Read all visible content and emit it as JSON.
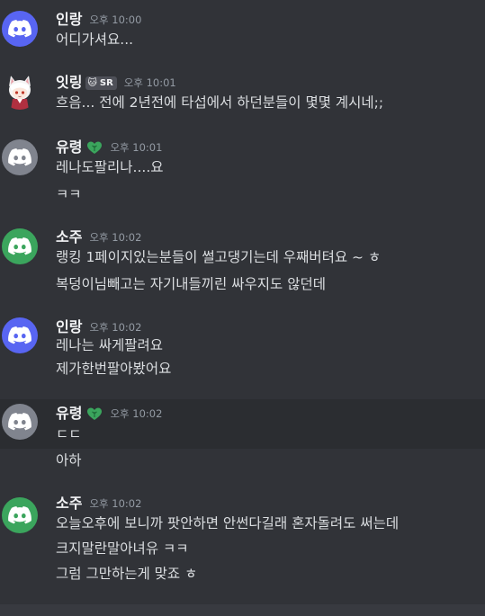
{
  "messages": [
    {
      "username": "인랑",
      "timestamp": "오후 10:00",
      "avatar": "discord-default-blurple",
      "lines": [
        "어디가셔요..."
      ]
    },
    {
      "username": "잇링",
      "timestamp": "오후 10:01",
      "avatar": "anime-character",
      "tag": {
        "icon": "cat-face-icon",
        "label": "SR"
      },
      "lines": [
        "흐음... 전에 2년전에 타섭에서 하던분들이 몇몇 계시네;;"
      ]
    },
    {
      "username": "유령",
      "timestamp": "오후 10:01",
      "avatar": "discord-default-gray",
      "badge": "green-heart-leaf-icon",
      "lines": [
        "레나도팔리나....요",
        "ㅋㅋ"
      ]
    },
    {
      "username": "소주",
      "timestamp": "오후 10:02",
      "avatar": "discord-default-green",
      "lines": [
        "랭킹 1페이지있는분들이 썰고댕기는데 우째버텨요 ~ ㅎ",
        "복덩이님빼고는 자기내들끼린 싸우지도 않던데"
      ]
    },
    {
      "username": "인랑",
      "timestamp": "오후 10:02",
      "avatar": "discord-default-blurple",
      "lines": [
        "레나는 싸게팔려요",
        "제가한번팔아봤어요"
      ]
    },
    {
      "username": "유령",
      "timestamp": "오후 10:02",
      "avatar": "discord-default-gray",
      "badge": "green-heart-leaf-icon",
      "lines": [
        "ㄷㄷ",
        "아하"
      ]
    },
    {
      "username": "소주",
      "timestamp": "오후 10:02",
      "avatar": "discord-default-green",
      "lines": [
        "오늘오후에 보니까 팟안하면 안썬다길래 혼자돌려도 써는데",
        "크지말란말아녀유 ㅋㅋ",
        "그럼 그만하는게 맞죠 ㅎ"
      ]
    }
  ],
  "colors": {
    "background": "#313338",
    "hover_background": "#2b2d31",
    "blurple": "#5865f2",
    "gray": "#80848e",
    "green": "#3ba55d",
    "badge_green": "#3ba55d"
  }
}
